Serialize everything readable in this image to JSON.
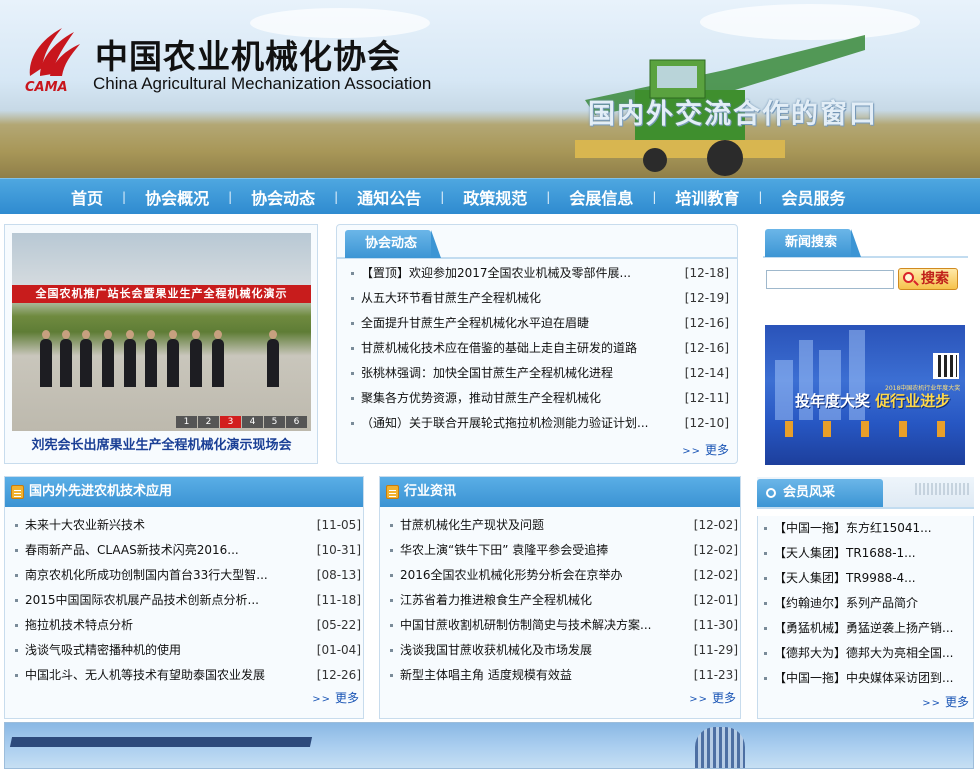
{
  "header": {
    "logo_abbr": "CAMA",
    "title_cn": "中国农业机械化协会",
    "title_en": "China Agricultural Mechanization Association",
    "slogan": "国内外交流合作的窗口"
  },
  "nav": {
    "items": [
      "首页",
      "协会概况",
      "协会动态",
      "通知公告",
      "政策规范",
      "会展信息",
      "培训教育",
      "会员服务"
    ],
    "separator": "|"
  },
  "slideshow": {
    "banner_text": "全国农机推广站长会暨果业生产全程机械化演示",
    "pages": [
      "1",
      "2",
      "3",
      "4",
      "5",
      "6"
    ],
    "active_page": "3",
    "caption": "刘宪会长出席果业生产全程机械化演示现场会"
  },
  "news": {
    "title": "协会动态",
    "items": [
      {
        "title": "【置顶】欢迎参加2017全国农业机械及零部件展...",
        "date": "[12-18]"
      },
      {
        "title": "从五大环节看甘蔗生产全程机械化",
        "date": "[12-19]"
      },
      {
        "title": "全面提升甘蔗生产全程机械化水平迫在眉睫",
        "date": "[12-16]"
      },
      {
        "title": "甘蔗机械化技术应在借鉴的基础上走自主研发的道路",
        "date": "[12-16]"
      },
      {
        "title": "张桃林强调：加快全国甘蔗生产全程机械化进程",
        "date": "[12-14]"
      },
      {
        "title": "聚集各方优势资源，推动甘蔗生产全程机械化",
        "date": "[12-11]"
      },
      {
        "title": "（通知）关于联合开展轮式拖拉机检测能力验证计划...",
        "date": "[12-10]"
      }
    ],
    "more": "更多",
    "more_arrows": ">>"
  },
  "search": {
    "title": "新闻搜索",
    "placeholder": "",
    "button": "搜索"
  },
  "ad": {
    "line1": "投年度大奖",
    "line2": "促行业进步",
    "small": "2018中国农机行业年度大奖活动"
  },
  "tech": {
    "title": "国内外先进农机技术应用",
    "items": [
      {
        "title": "未来十大农业新兴技术",
        "date": "[11-05]"
      },
      {
        "title": "春雨新产品、CLAAS新技术闪亮2016...",
        "date": "[10-31]"
      },
      {
        "title": "南京农机化所成功创制国内首台33行大型智...",
        "date": "[08-13]"
      },
      {
        "title": "2015中国国际农机展产品技术创新点分析...",
        "date": "[11-18]"
      },
      {
        "title": "拖拉机技术特点分析",
        "date": "[05-22]"
      },
      {
        "title": "浅谈气吸式精密播种机的使用",
        "date": "[01-04]"
      },
      {
        "title": "中国北斗、无人机等技术有望助泰国农业发展",
        "date": "[12-26]"
      }
    ],
    "more": "更多",
    "more_arrows": ">>"
  },
  "industry": {
    "title": "行业资讯",
    "items": [
      {
        "title": "甘蔗机械化生产现状及问题",
        "date": "[12-02]"
      },
      {
        "title": "华农上演“铁牛下田” 袁隆平参会受追捧",
        "date": "[12-02]"
      },
      {
        "title": "2016全国农业机械化形势分析会在京举办",
        "date": "[12-02]"
      },
      {
        "title": "江苏省着力推进粮食生产全程机械化",
        "date": "[12-01]"
      },
      {
        "title": "中国甘蔗收割机研制仿制简史与技术解决方案...",
        "date": "[11-30]"
      },
      {
        "title": "浅谈我国甘蔗收获机械化及市场发展",
        "date": "[11-29]"
      },
      {
        "title": "新型主体唱主角 适度规模有效益",
        "date": "[11-23]"
      }
    ],
    "more": "更多",
    "more_arrows": ">>"
  },
  "members": {
    "title": "会员风采",
    "items": [
      "【中国一拖】东方红15041...",
      "【天人集团】TR1688-1...",
      "【天人集团】TR9988-4...",
      "【约翰迪尔】系列产品简介",
      "【勇猛机械】勇猛逆袭上扬产销...",
      "【德邦大为】德邦大为亮相全国...",
      "【中国一拖】中央媒体采访团到..."
    ],
    "more": "更多",
    "more_arrows": ">>"
  }
}
